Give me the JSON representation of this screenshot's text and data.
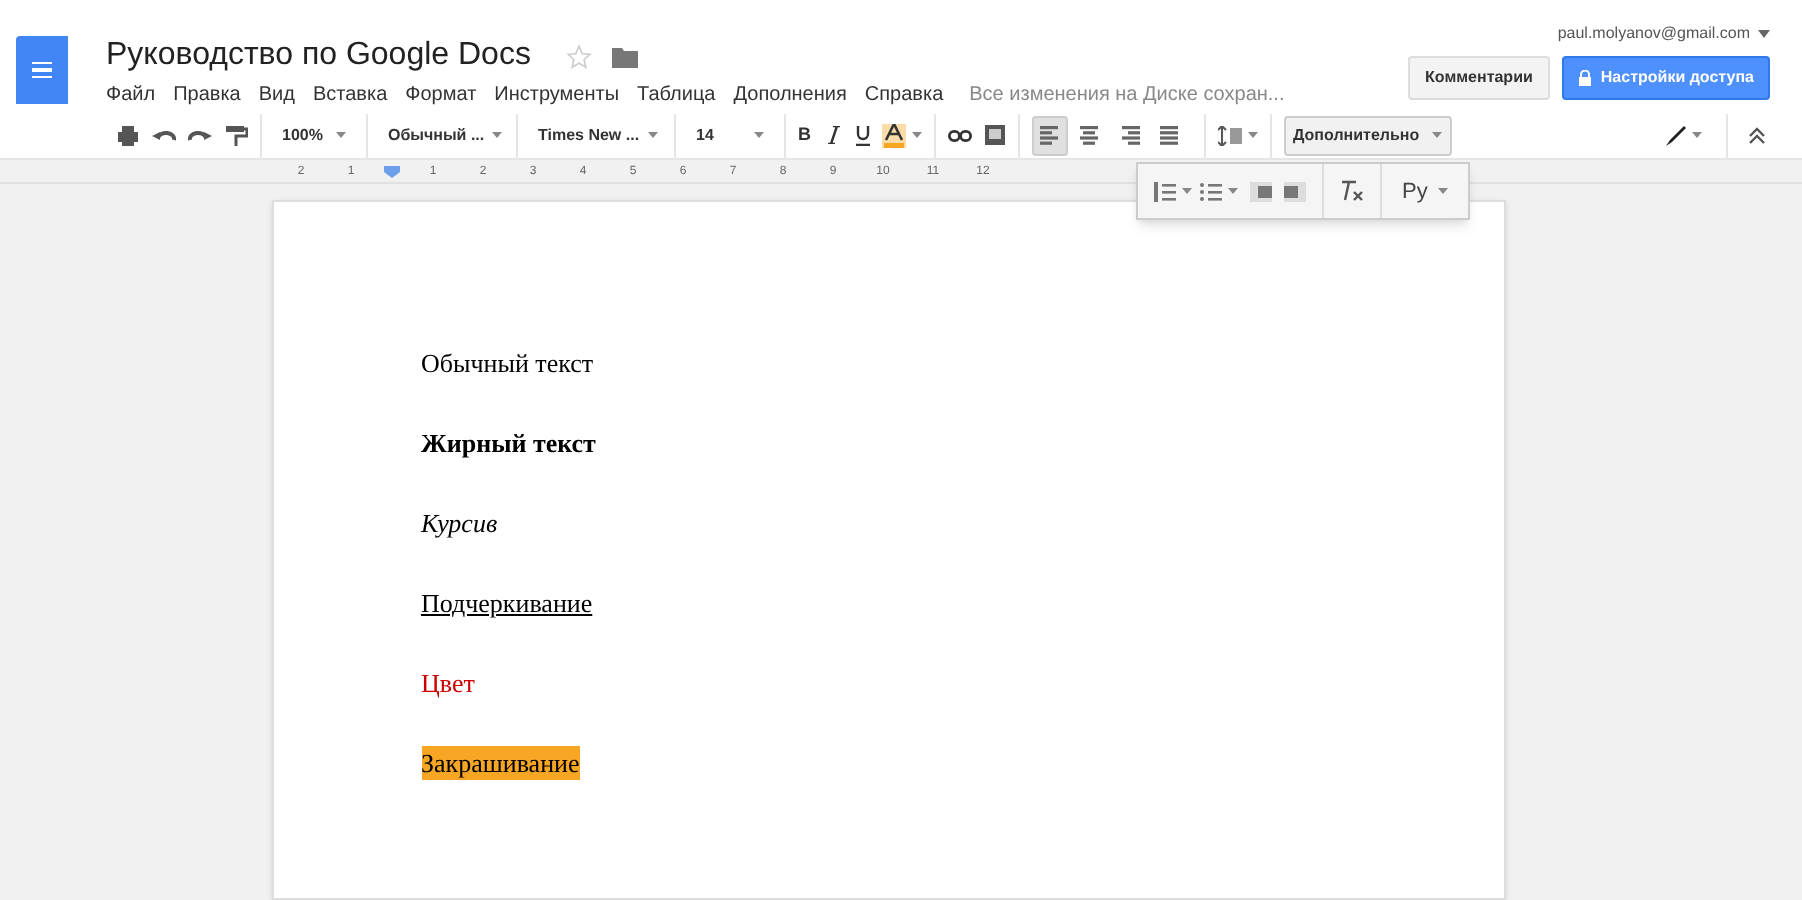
{
  "header": {
    "title": "Руководство по Google Docs",
    "starred": false,
    "account": "paul.molyanov@gmail.com",
    "comments_button": "Комментарии",
    "share_button": "Настройки доступа"
  },
  "menu": [
    "Файл",
    "Правка",
    "Вид",
    "Вставка",
    "Формат",
    "Инструменты",
    "Таблица",
    "Дополнения",
    "Справка"
  ],
  "save_status": "Все изменения на Диске сохран...",
  "toolbar": {
    "zoom": "100%",
    "style": "Обычный ...",
    "font": "Times New ...",
    "size": "14",
    "bold": "B",
    "more": "Дополнительно",
    "alignment": [
      {
        "kind": "left",
        "selected": true
      },
      {
        "kind": "center",
        "selected": false
      },
      {
        "kind": "right",
        "selected": false
      },
      {
        "kind": "justify",
        "selected": false
      }
    ]
  },
  "overflow_menu": {
    "input_tools": "Ру"
  },
  "ruler": [
    "2",
    "1",
    "1",
    "2",
    "3",
    "4",
    "5",
    "6",
    "7",
    "8",
    "9",
    "10",
    "11",
    "12"
  ],
  "paragraphs": [
    {
      "text": "Обычный текст",
      "kind": "normal"
    },
    {
      "text": "Жирный текст",
      "kind": "bold"
    },
    {
      "text": "Курсив",
      "kind": "italic"
    },
    {
      "text": "Подчеркивание",
      "kind": "underline"
    },
    {
      "text": "Цвет",
      "kind": "color",
      "color": "#cc0000"
    },
    {
      "text": "Закрашивание",
      "kind": "highlight",
      "color": "#f6a623"
    }
  ]
}
